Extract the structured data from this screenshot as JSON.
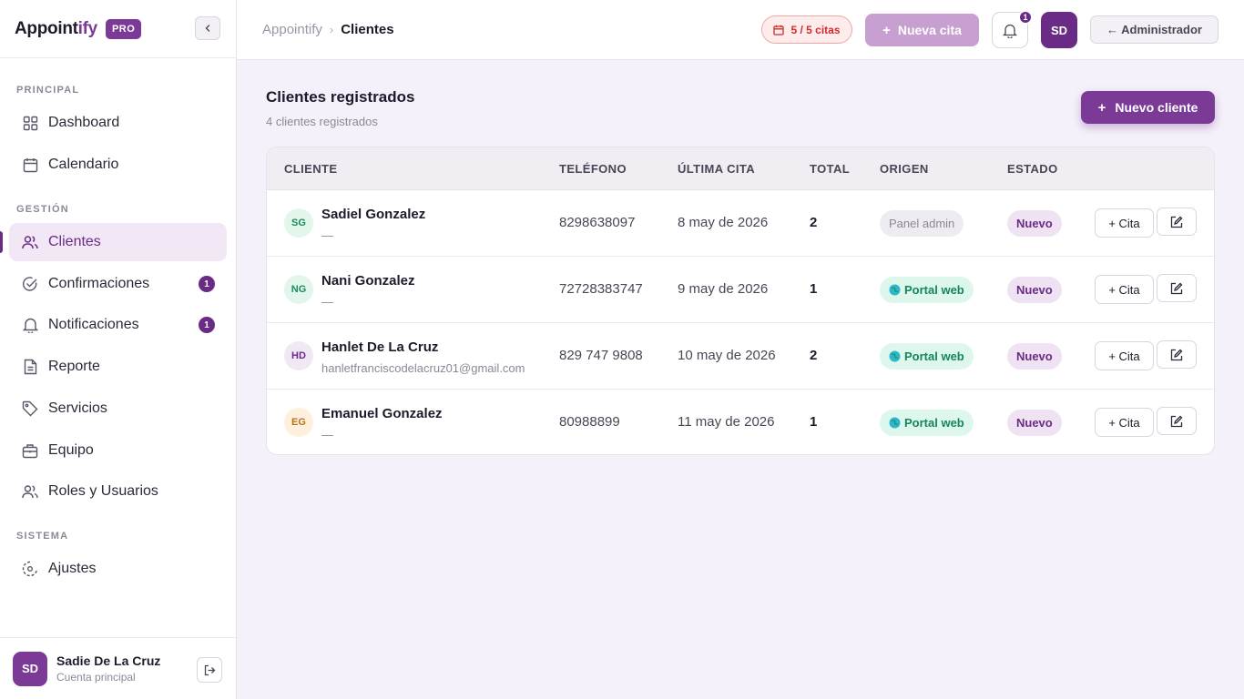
{
  "brand": {
    "name_main": "Appoint",
    "name_accent": "ify",
    "badge": "PRO"
  },
  "sidebar": {
    "sections": [
      "PRINCIPAL",
      "GESTIÓN",
      "SISTEMA"
    ],
    "items": [
      {
        "label": "Dashboard",
        "icon": "grid-icon"
      },
      {
        "label": "Calendario",
        "icon": "calendar-icon"
      },
      {
        "label": "Clientes",
        "icon": "users-icon",
        "active": true
      },
      {
        "label": "Confirmaciones",
        "icon": "check-circle-icon",
        "badge": "1"
      },
      {
        "label": "Notificaciones",
        "icon": "bell-icon",
        "badge": "1"
      },
      {
        "label": "Reporte",
        "icon": "document-icon"
      },
      {
        "label": "Servicios",
        "icon": "tag-icon"
      },
      {
        "label": "Equipo",
        "icon": "briefcase-icon"
      },
      {
        "label": "Roles y Usuarios",
        "icon": "users-icon"
      },
      {
        "label": "Ajustes",
        "icon": "settings-icon"
      }
    ],
    "user": {
      "initials": "SD",
      "name": "Sadie De La Cruz",
      "role": "Cuenta principal"
    }
  },
  "header": {
    "breadcrumb_root": "Appointify",
    "breadcrumb_sep": "›",
    "breadcrumb_current": "Clientes",
    "citas_count": "5 / 5 citas",
    "new_appointment": "Nueva cita",
    "notifications_count": "1",
    "avatar_initials": "SD",
    "admin_label": "← Administrador"
  },
  "main": {
    "title": "Clientes registrados",
    "subtitle": "4 clientes registrados",
    "new_client": "Nuevo cliente",
    "columns": [
      "CLIENTE",
      "TELÉFONO",
      "ÚLTIMA CITA",
      "TOTAL",
      "ORIGEN",
      "ESTADO"
    ],
    "rows": [
      {
        "initials": "SG",
        "name": "Sadiel Gonzalez",
        "email": "—",
        "phone": "8298638097",
        "last": "8 may de 2026",
        "total": "2",
        "origin": "Panel admin",
        "status": "Nuevo",
        "cita": "+ Cita"
      },
      {
        "initials": "NG",
        "name": "Nani Gonzalez",
        "email": "—",
        "phone": "72728383747",
        "last": "9 may de 2026",
        "total": "1",
        "origin": "Portal web",
        "status": "Nuevo",
        "cita": "+ Cita"
      },
      {
        "initials": "HD",
        "name": "Hanlet De La Cruz",
        "email": "hanletfranciscodelacruz01@gmail.com",
        "phone": "829 747 9808",
        "last": "10 may de 2026",
        "total": "2",
        "origin": "Portal web",
        "status": "Nuevo",
        "cita": "+ Cita"
      },
      {
        "initials": "EG",
        "name": "Emanuel Gonzalez",
        "email": "—",
        "phone": "80988899",
        "last": "11 may de 2026",
        "total": "1",
        "origin": "Portal web",
        "status": "Nuevo",
        "cita": "+ Cita"
      }
    ]
  },
  "colors": {
    "accent": "#7b3a96",
    "accent_dark": "#6a2b86",
    "success": "#14865b",
    "danger": "#d52a2a"
  }
}
